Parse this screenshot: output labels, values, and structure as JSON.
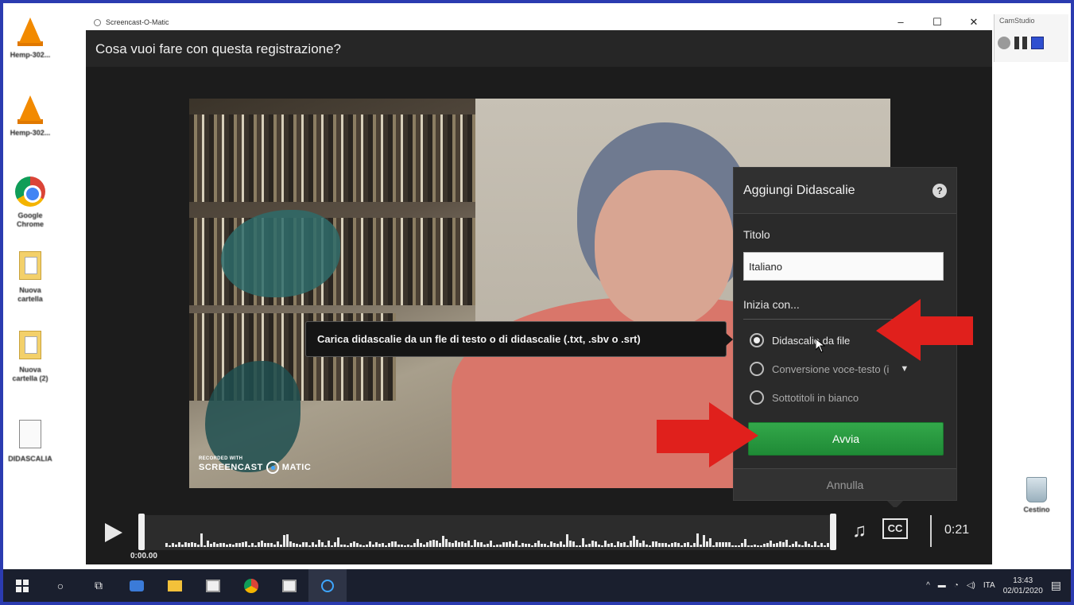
{
  "desktop": {
    "icons": [
      {
        "label": "Hemp-302..."
      },
      {
        "label": "Hemp-302..."
      },
      {
        "label": "Google Chrome"
      },
      {
        "label": "Nuova cartella"
      },
      {
        "label": "Nuova cartella (2)"
      },
      {
        "label": "DIDASCALIA"
      }
    ],
    "recycle_label": "Cestino"
  },
  "window": {
    "title": "Screencast-O-Matic",
    "header": "Cosa vuoi fare con questa registrazione?",
    "controls": {
      "minimize": "–",
      "maximize": "☐",
      "close": "✕"
    }
  },
  "video": {
    "watermark_small": "RECORDED WITH",
    "watermark_left": "SCREENCAST",
    "watermark_right": "MATIC"
  },
  "tooltip": "Carica didascalie da un fle di testo o di didascalie (.txt, .sbv o .srt)",
  "captions_panel": {
    "title": "Aggiungi Didascalie",
    "help": "?",
    "title_label": "Titolo",
    "title_value": "Italiano",
    "start_with_label": "Inizia con...",
    "options": [
      {
        "label": "Didascalie da file",
        "selected": true
      },
      {
        "label": "Conversione voce-testo (i",
        "selected": false
      },
      {
        "label": "Sottotitoli in bianco",
        "selected": false
      }
    ],
    "start_button": "Avvia",
    "cancel_button": "Annulla"
  },
  "player": {
    "time_start": "0:00.00",
    "time_end": "0:21",
    "cc_label": "CC",
    "music_icon": "♫"
  },
  "camstudio": {
    "title": "CamStudio"
  },
  "taskbar": {
    "language": "ITA",
    "time": "13:43",
    "date": "02/01/2020"
  },
  "colors": {
    "accent_green": "#2a9a3f",
    "arrow_red": "#e0201c",
    "frame_blue": "#2b3bb0"
  }
}
